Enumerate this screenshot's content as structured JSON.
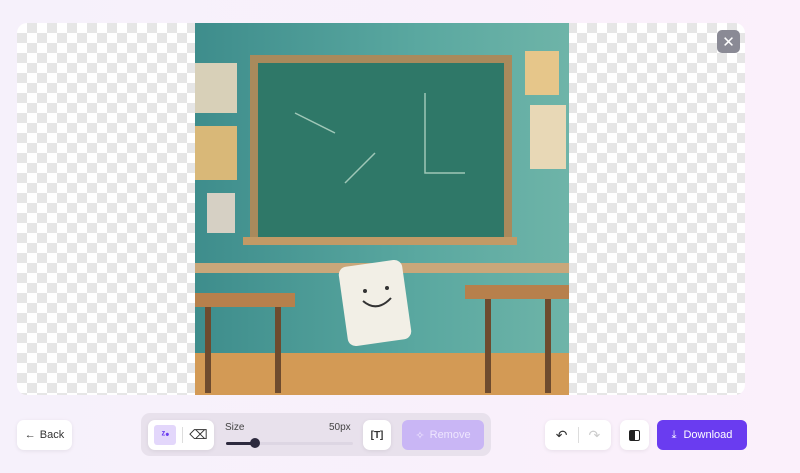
{
  "close_label": "✕",
  "back": {
    "label": "Back",
    "icon": "arrow-left-icon"
  },
  "brush": {
    "size_label": "Size",
    "size_value": "50px",
    "size_fraction": 0.23
  },
  "remove_label": "Remove",
  "download_label": "Download",
  "colors": {
    "accent": "#6a3cf0",
    "remove_disabled": "#c9b6f5"
  }
}
